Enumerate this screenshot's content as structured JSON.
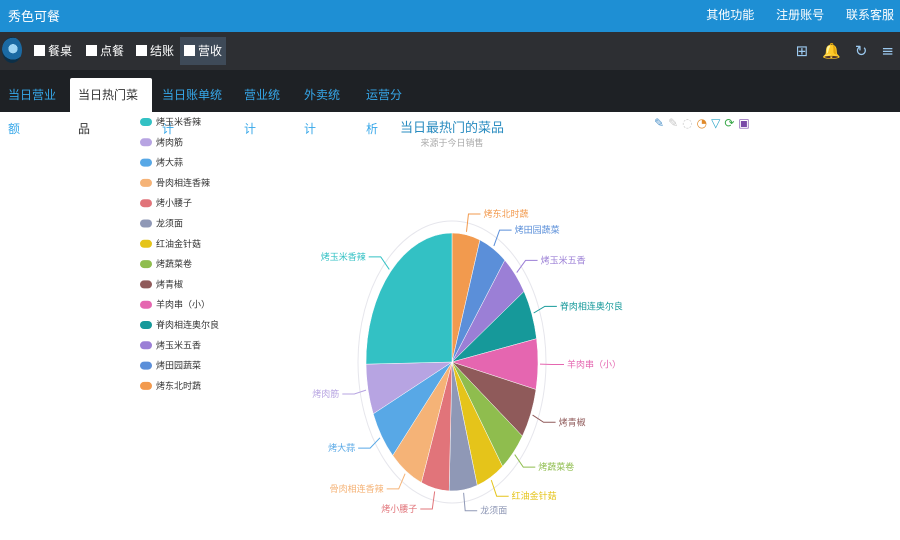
{
  "app": {
    "title": "秀色可餐"
  },
  "top_links": [
    "其他功能",
    "注册账号",
    "联系客服"
  ],
  "toolbar": {
    "buttons": [
      {
        "label": "餐桌",
        "icon": "table-icon"
      },
      {
        "label": "点餐",
        "icon": "book-icon"
      },
      {
        "label": "结账",
        "icon": "calculator-icon"
      },
      {
        "label": "营收",
        "icon": "bar-chart-icon"
      }
    ],
    "active": 3,
    "right_icons": [
      {
        "name": "gift-icon",
        "glyph": "⊞"
      },
      {
        "name": "bell-icon",
        "glyph": "🔔"
      },
      {
        "name": "refresh-icon",
        "glyph": "↻"
      },
      {
        "name": "menu-icon",
        "glyph": "≡"
      }
    ]
  },
  "tabs": [
    "当日营业额",
    "当日热门菜品",
    "当日账单统计",
    "营业统计",
    "外卖统计",
    "运营分析"
  ],
  "active_tab": 1,
  "chart_toolbox_icons": [
    {
      "name": "mark-icon",
      "glyph": "✎",
      "color": "#4a90c8"
    },
    {
      "name": "mark-undo-icon",
      "glyph": "✎",
      "color": "#c8c8c8"
    },
    {
      "name": "mark-clear-icon",
      "glyph": "◌",
      "color": "#c8c8c8"
    },
    {
      "name": "pie-type-icon",
      "glyph": "◔",
      "color": "#e08a2a"
    },
    {
      "name": "funnel-type-icon",
      "glyph": "▽",
      "color": "#2aa5c8"
    },
    {
      "name": "restore-icon",
      "glyph": "⟳",
      "color": "#3aa84a"
    },
    {
      "name": "save-image-icon",
      "glyph": "▣",
      "color": "#7a4aa8"
    }
  ],
  "chart_data": {
    "type": "pie",
    "title": "当日最热门的菜品",
    "subtitle": "来源于今日销售",
    "legend_position": "top-left",
    "slices": [
      {
        "name": "烤东北时蔬",
        "value": 5,
        "color": "#f29a4e"
      },
      {
        "name": "烤田园蔬菜",
        "value": 5,
        "color": "#5b8fd9"
      },
      {
        "name": "烤玉米五香",
        "value": 5,
        "color": "#9b7fd6"
      },
      {
        "name": "脊肉相连奥尔良",
        "value": 6,
        "color": "#16999a"
      },
      {
        "name": "羊肉串（小）",
        "value": 6,
        "color": "#e566b0"
      },
      {
        "name": "烤青椒",
        "value": 6,
        "color": "#8f5a5a"
      },
      {
        "name": "烤蔬菜卷",
        "value": 5,
        "color": "#8fbd4e"
      },
      {
        "name": "红油金针菇",
        "value": 5,
        "color": "#e5c41a"
      },
      {
        "name": "龙须面",
        "value": 5,
        "color": "#8f98b6"
      },
      {
        "name": "烤小腰子",
        "value": 5,
        "color": "#e1747a"
      },
      {
        "name": "骨肉相连香辣",
        "value": 6,
        "color": "#f5b377"
      },
      {
        "name": "烤大蒜",
        "value": 6,
        "color": "#58a8e6"
      },
      {
        "name": "烤肉筋",
        "value": 6,
        "color": "#b7a4e2"
      },
      {
        "name": "烤玉米香辣",
        "value": 24,
        "color": "#33c1c4"
      }
    ],
    "legend_items": [
      "烤玉米香辣",
      "烤肉筋",
      "烤大蒜",
      "骨肉相连香辣",
      "烤小腰子",
      "龙须面",
      "红油金针菇",
      "烤蔬菜卷",
      "烤青椒",
      "羊肉串（小）",
      "脊肉相连奥尔良",
      "烤玉米五香",
      "烤田园蔬菜",
      "烤东北时蔬"
    ]
  }
}
